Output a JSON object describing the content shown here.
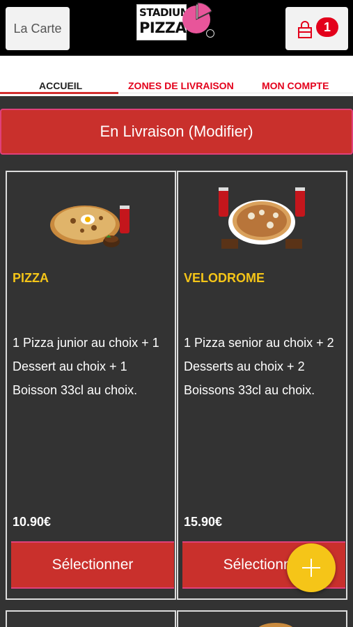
{
  "header": {
    "menu_label": "La Carte",
    "logo_line1": "STADIUM",
    "logo_line2": "PIZZA",
    "cart_count": "1",
    "accent_color": "#e3001b"
  },
  "tabs": [
    {
      "label": "ACCUEIL",
      "active": true
    },
    {
      "label": "ZONES DE LIVRAISON",
      "active": false
    },
    {
      "label": "MON COMPTE",
      "active": false
    }
  ],
  "delivery": {
    "label": "En Livraison (Modifier)"
  },
  "products": [
    {
      "title": "PIZZA",
      "description": "1 Pizza junior au choix  + 1 Dessert au choix  + 1 Boisson 33cl au choix.",
      "price": "10.90€",
      "button_label": "Sélectionner"
    },
    {
      "title": "VELODROME",
      "description": "1 Pizza senior au choix  + 2 Desserts au choix  + 2 Boissons 33cl au choix.",
      "price": "15.90€",
      "button_label": "Sélectionner"
    }
  ],
  "fab": {
    "icon": "plus-icon"
  }
}
